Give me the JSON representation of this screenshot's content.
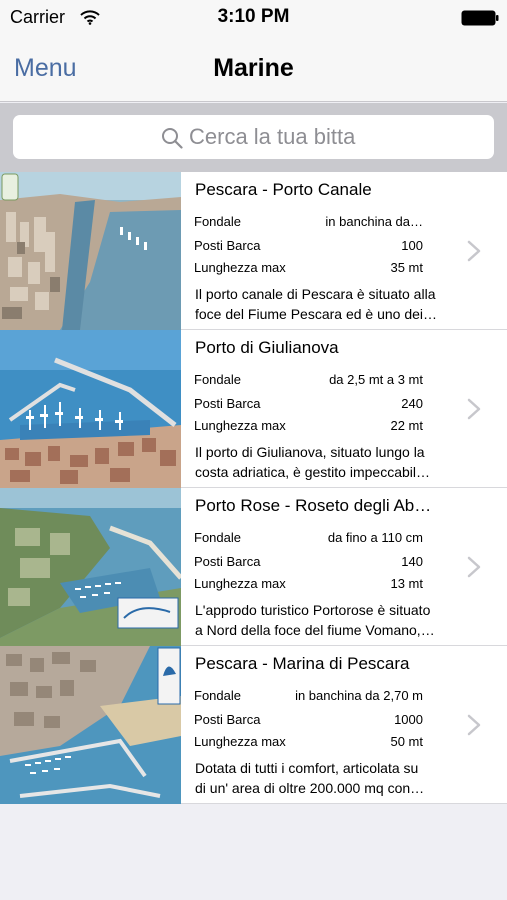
{
  "status": {
    "carrier": "Carrier",
    "time": "3:10 PM"
  },
  "nav": {
    "menu_label": "Menu",
    "title": "Marine"
  },
  "search": {
    "placeholder": "Cerca la tua bitta"
  },
  "spec_labels": {
    "depth": "Fondale",
    "berths": "Posti Barca",
    "max_length": "Lunghezza max"
  },
  "marinas": [
    {
      "name": "Pescara - Porto Canale",
      "depth": "in banchina da…",
      "berths": "100",
      "max_length": "35 mt",
      "desc_line1": "Il porto canale di Pescara è situato alla",
      "desc_line2": "foce del Fiume Pescara ed è uno dei…"
    },
    {
      "name": "Porto di Giulianova",
      "depth": "da 2,5 mt a 3 mt",
      "berths": "240",
      "max_length": "22 mt",
      "desc_line1": "Il porto di Giulianova, situato lungo la",
      "desc_line2": "costa adriatica, è gestito impeccabil…"
    },
    {
      "name": "Porto Rose - Roseto degli Ab…",
      "depth": "da fino a 110 cm",
      "berths": "140",
      "max_length": "13 mt",
      "desc_line1": "L'approdo turistico Portorose è situato",
      "desc_line2": "a Nord della foce del fiume Vomano,…"
    },
    {
      "name": "Pescara - Marina di Pescara",
      "depth": "in banchina da 2,70 m",
      "berths": "1000",
      "max_length": "50 mt",
      "desc_line1": "Dotata di tutti i comfort, articolata su",
      "desc_line2": "di un' area di oltre 200.000 mq con…"
    }
  ],
  "colors": {
    "accent": "#4a6da3",
    "search_bar_bg": "#c9c9ce",
    "page_bg": "#efeff4"
  },
  "icons": {
    "search": "search-icon",
    "chevron": "chevron-right-icon",
    "wifi": "wifi-icon",
    "battery": "battery-icon"
  }
}
